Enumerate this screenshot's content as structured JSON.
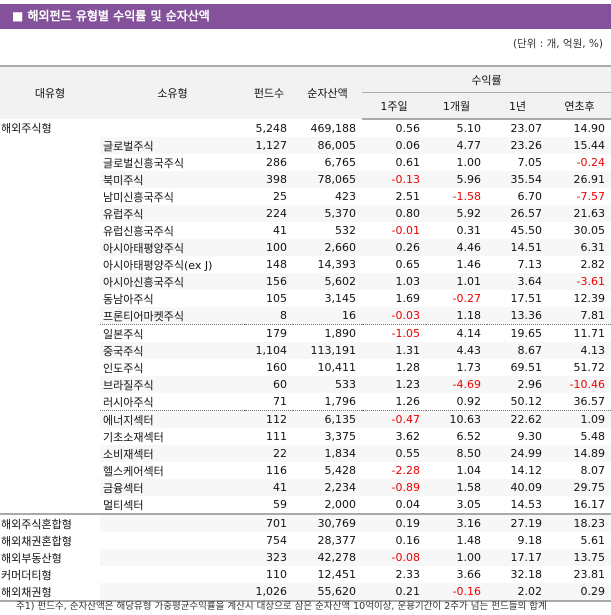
{
  "title": "■ 해외펀드 유형별 수익률 및 순자산액",
  "unit": "(단위 : 개, 억원, %)",
  "headers": {
    "major": "대유형",
    "minor": "소유형",
    "funds": "펀드수",
    "nav": "순자산액",
    "returns": "수익률",
    "w1": "1주일",
    "m1": "1개월",
    "y1": "1년",
    "ytd": "연초후"
  },
  "rows": [
    [
      "해외주식형",
      "",
      "5,248",
      "469,188",
      "0.56",
      "5.10",
      "23.07",
      "14.90"
    ],
    [
      "",
      "글로벌주식",
      "1,127",
      "86,005",
      "0.06",
      "4.77",
      "23.26",
      "15.44"
    ],
    [
      "",
      "글로벌신흥국주식",
      "286",
      "6,765",
      "0.61",
      "1.00",
      "7.05",
      "-0.24"
    ],
    [
      "",
      "북미주식",
      "398",
      "78,065",
      "-0.13",
      "5.96",
      "35.54",
      "26.91"
    ],
    [
      "",
      "남미신흥국주식",
      "25",
      "423",
      "2.51",
      "-1.58",
      "6.70",
      "-7.57"
    ],
    [
      "",
      "유럽주식",
      "224",
      "5,370",
      "0.80",
      "5.92",
      "26.57",
      "21.63"
    ],
    [
      "",
      "유럽신흥국주식",
      "41",
      "532",
      "-0.01",
      "0.31",
      "45.50",
      "30.05"
    ],
    [
      "",
      "아시아태평양주식",
      "100",
      "2,660",
      "0.26",
      "4.46",
      "14.51",
      "6.31"
    ],
    [
      "",
      "아시아태평양주식(ex J)",
      "148",
      "14,393",
      "0.65",
      "1.46",
      "7.13",
      "2.82"
    ],
    [
      "",
      "아시아신흥국주식",
      "156",
      "5,602",
      "1.03",
      "1.01",
      "3.64",
      "-3.61"
    ],
    [
      "",
      "동남아주식",
      "105",
      "3,145",
      "1.69",
      "-0.27",
      "17.51",
      "12.39"
    ],
    [
      "",
      "프론티어마켓주식",
      "8",
      "16",
      "-0.03",
      "1.18",
      "13.36",
      "7.81"
    ],
    [
      "",
      "일본주식",
      "179",
      "1,890",
      "-1.05",
      "4.14",
      "19.65",
      "11.71"
    ],
    [
      "",
      "중국주식",
      "1,104",
      "113,191",
      "1.31",
      "4.43",
      "8.67",
      "4.13"
    ],
    [
      "",
      "인도주식",
      "160",
      "10,411",
      "1.28",
      "1.73",
      "69.51",
      "51.72"
    ],
    [
      "",
      "브라질주식",
      "60",
      "533",
      "1.23",
      "-4.69",
      "2.96",
      "-10.46"
    ],
    [
      "",
      "러시아주식",
      "71",
      "1,796",
      "1.26",
      "0.92",
      "50.12",
      "36.57"
    ],
    [
      "",
      "에너지섹터",
      "112",
      "6,135",
      "-0.47",
      "10.63",
      "22.62",
      "1.09"
    ],
    [
      "",
      "기초소재섹터",
      "111",
      "3,375",
      "3.62",
      "6.52",
      "9.30",
      "5.48"
    ],
    [
      "",
      "소비재섹터",
      "22",
      "1,834",
      "0.55",
      "8.50",
      "24.99",
      "14.89"
    ],
    [
      "",
      "헬스케어섹터",
      "116",
      "5,428",
      "-2.28",
      "1.04",
      "14.12",
      "8.07"
    ],
    [
      "",
      "금융섹터",
      "41",
      "2,234",
      "-0.89",
      "1.58",
      "40.09",
      "29.75"
    ],
    [
      "",
      "멀티섹터",
      "59",
      "2,000",
      "0.04",
      "3.05",
      "14.53",
      "16.17"
    ],
    [
      "해외주식혼합형",
      "",
      "701",
      "30,769",
      "0.19",
      "3.16",
      "27.19",
      "18.23"
    ],
    [
      "해외채권혼합형",
      "",
      "754",
      "28,377",
      "0.16",
      "1.48",
      "9.18",
      "5.61"
    ],
    [
      "해외부동산형",
      "",
      "323",
      "42,278",
      "-0.08",
      "1.00",
      "17.17",
      "13.75"
    ],
    [
      "커머더티형",
      "",
      "110",
      "12,451",
      "2.33",
      "3.66",
      "32.18",
      "23.81"
    ],
    [
      "해외채권형",
      "",
      "1,026",
      "55,620",
      "0.21",
      "-0.16",
      "2.02",
      "0.29"
    ]
  ],
  "footnote": "주1) 펀드수, 순자산액은 해당유형 가중평균수익률을 계산시 대상으로 삼은 순자산액 10억이상, 운용기간이 2주가 넘는 펀드들의 합계",
  "colors": {
    "title_bar": "#84529a",
    "negative": "#ee0000"
  }
}
